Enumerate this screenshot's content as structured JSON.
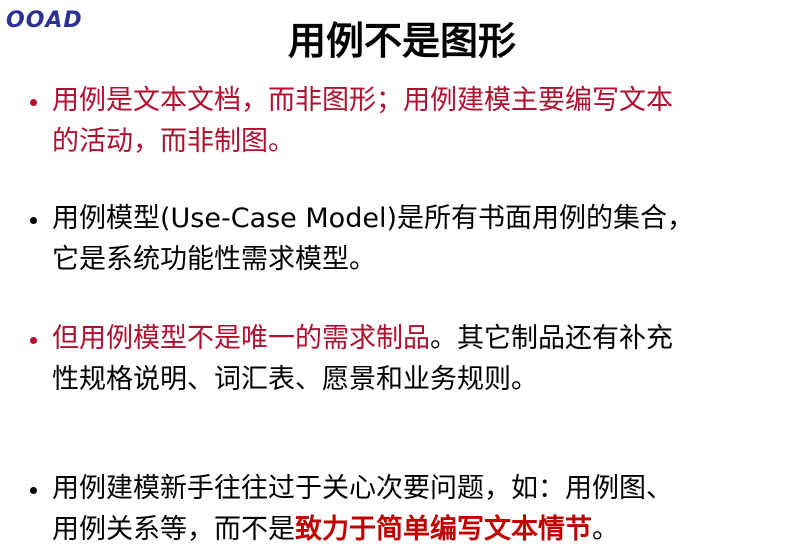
{
  "header": {
    "logo": "OOAD",
    "title": "用例不是图形"
  },
  "colors": {
    "logo": "#2e3192",
    "accent_red": "#b0102f",
    "emphasis_red": "#c00000"
  },
  "bullets": [
    {
      "line1": "用例是文本文档，而非图形；用例建模主要编写文本",
      "line2": "的活动，而非制图。"
    },
    {
      "line1": "用例模型(Use-Case Model)是所有书面用例的集合，",
      "line2": "它是系统功能性需求模型。"
    },
    {
      "line1_red": "但用例模型不是唯一的需求制品",
      "line1_black": "。其它制品还有补充",
      "line2": "性规格说明、词汇表、愿景和业务规则。"
    },
    {
      "line1": "用例建模新手往往过于关心次要问题，如：用例图、",
      "line2_black": "用例关系等，而不是",
      "line2_bold": "致力于简单编写文本情节",
      "line2_end": "。"
    }
  ]
}
